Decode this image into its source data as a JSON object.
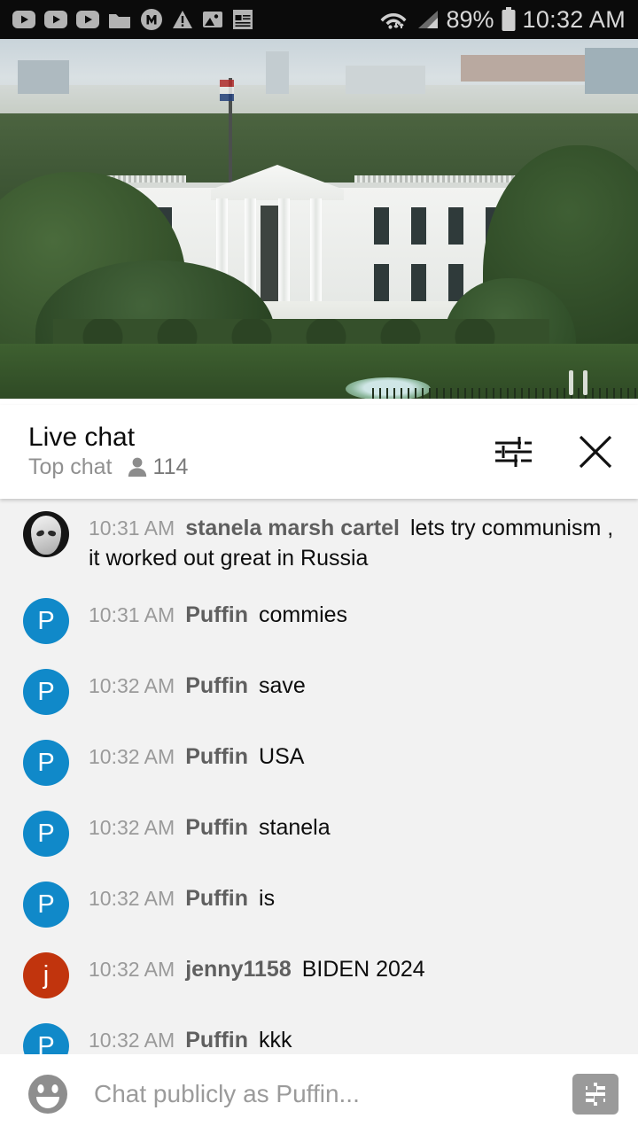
{
  "status_bar": {
    "time": "10:32 AM",
    "battery_percent": "89%",
    "left_icons": [
      "youtube-play-icon",
      "youtube-play-icon",
      "youtube-play-icon",
      "folder-icon",
      "m-circle-icon",
      "warning-triangle-icon",
      "image-icon",
      "news-icon"
    ],
    "right_icons": [
      "wifi-icon",
      "cell-signal-icon",
      "battery-icon"
    ]
  },
  "video": {
    "description": "White House live stream",
    "progress_percent": 100,
    "progress_color": "#ee0f0f"
  },
  "chat_header": {
    "title": "Live chat",
    "subtitle": "Top chat",
    "viewer_count": "114",
    "viewer_icon": "person-icon",
    "settings_icon": "tune-sliders-icon",
    "close_icon": "close-x-icon"
  },
  "messages": [
    {
      "time": "10:31 AM",
      "author": "stanela marsh cartel",
      "text": "lets try communism , it worked out great in Russia",
      "avatar_type": "alien-photo",
      "avatar_initial": "",
      "avatar_color": "#151515"
    },
    {
      "time": "10:31 AM",
      "author": "Puffin",
      "text": "commies",
      "avatar_type": "initial",
      "avatar_initial": "P",
      "avatar_color": "#1089c9"
    },
    {
      "time": "10:32 AM",
      "author": "Puffin",
      "text": "save",
      "avatar_type": "initial",
      "avatar_initial": "P",
      "avatar_color": "#1089c9"
    },
    {
      "time": "10:32 AM",
      "author": "Puffin",
      "text": "USA",
      "avatar_type": "initial",
      "avatar_initial": "P",
      "avatar_color": "#1089c9"
    },
    {
      "time": "10:32 AM",
      "author": "Puffin",
      "text": "stanela",
      "avatar_type": "initial",
      "avatar_initial": "P",
      "avatar_color": "#1089c9"
    },
    {
      "time": "10:32 AM",
      "author": "Puffin",
      "text": "is",
      "avatar_type": "initial",
      "avatar_initial": "P",
      "avatar_color": "#1089c9"
    },
    {
      "time": "10:32 AM",
      "author": "jenny1158",
      "text": "BIDEN 2024",
      "avatar_type": "initial",
      "avatar_initial": "j",
      "avatar_color": "#c1340d"
    },
    {
      "time": "10:32 AM",
      "author": "Puffin",
      "text": "kkk",
      "avatar_type": "initial",
      "avatar_initial": "P",
      "avatar_color": "#1089c9"
    }
  ],
  "input_bar": {
    "placeholder": "Chat publicly as Puffin...",
    "value": "",
    "emoji_icon": "emoji-smiley-icon",
    "superchat_icon": "dollar-sign-icon"
  }
}
